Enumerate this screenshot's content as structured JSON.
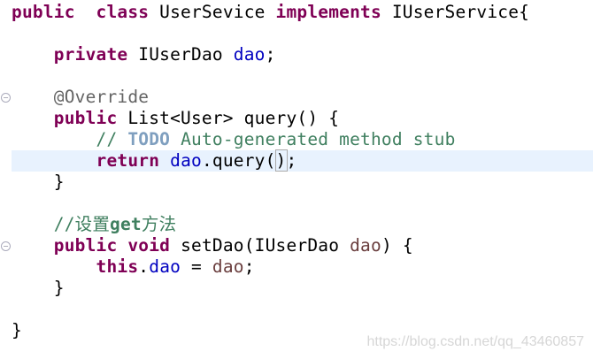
{
  "code_lines": [
    {
      "tokens": [
        [
          "kw",
          "public"
        ],
        [
          "",
          "  "
        ],
        [
          "kw",
          "class"
        ],
        [
          "",
          " UserSevice "
        ],
        [
          "kw",
          "implements"
        ],
        [
          "",
          " IUserService{"
        ]
      ]
    },
    {
      "tokens": []
    },
    {
      "tokens": [
        [
          "",
          "    "
        ],
        [
          "kw",
          "private"
        ],
        [
          "",
          " IUserDao "
        ],
        [
          "fld",
          "dao"
        ],
        [
          "",
          ";"
        ]
      ]
    },
    {
      "tokens": []
    },
    {
      "tokens": [
        [
          "",
          "    "
        ],
        [
          "ann",
          "@Override"
        ]
      ],
      "fold": true
    },
    {
      "tokens": [
        [
          "",
          "    "
        ],
        [
          "kw",
          "public"
        ],
        [
          "",
          " List<User> query() {"
        ]
      ]
    },
    {
      "tokens": [
        [
          "",
          "        "
        ],
        [
          "cm",
          "// "
        ],
        [
          "todo",
          "TODO"
        ],
        [
          "cm",
          " Auto-generated method stub"
        ]
      ]
    },
    {
      "tokens": [
        [
          "",
          "        "
        ],
        [
          "kw",
          "return"
        ],
        [
          "",
          " "
        ],
        [
          "fld",
          "dao"
        ],
        [
          "",
          ".query("
        ],
        [
          "cur",
          ")"
        ],
        [
          "",
          ";"
        ]
      ],
      "current": true
    },
    {
      "tokens": [
        [
          "",
          "    }"
        ]
      ]
    },
    {
      "tokens": []
    },
    {
      "tokens": [
        [
          "",
          "    "
        ],
        [
          "cm",
          "//设置"
        ],
        [
          "cmb",
          "get"
        ],
        [
          "cm",
          "方法"
        ]
      ]
    },
    {
      "tokens": [
        [
          "",
          "    "
        ],
        [
          "kw",
          "public"
        ],
        [
          "",
          " "
        ],
        [
          "kw",
          "void"
        ],
        [
          "",
          " setDao(IUserDao "
        ],
        [
          "par",
          "dao"
        ],
        [
          "",
          ") {"
        ]
      ],
      "fold": true
    },
    {
      "tokens": [
        [
          "",
          "        "
        ],
        [
          "kw",
          "this"
        ],
        [
          "",
          "."
        ],
        [
          "fld",
          "dao"
        ],
        [
          "",
          " = "
        ],
        [
          "par",
          "dao"
        ],
        [
          "",
          ";"
        ]
      ]
    },
    {
      "tokens": [
        [
          "",
          "    }"
        ]
      ]
    },
    {
      "tokens": []
    },
    {
      "tokens": [
        [
          "",
          "}"
        ]
      ]
    }
  ],
  "fold_icon": "collapse-minus-icon",
  "watermark": "https://blog.csdn.net/qq_43460857",
  "colors": {
    "keyword": "#7f0055",
    "field": "#0000c0",
    "comment": "#3f7f5f",
    "todo": "#7f9fbf",
    "annotation": "#646464",
    "parameter": "#6a3e3e",
    "current_line": "#e8f2fe"
  }
}
